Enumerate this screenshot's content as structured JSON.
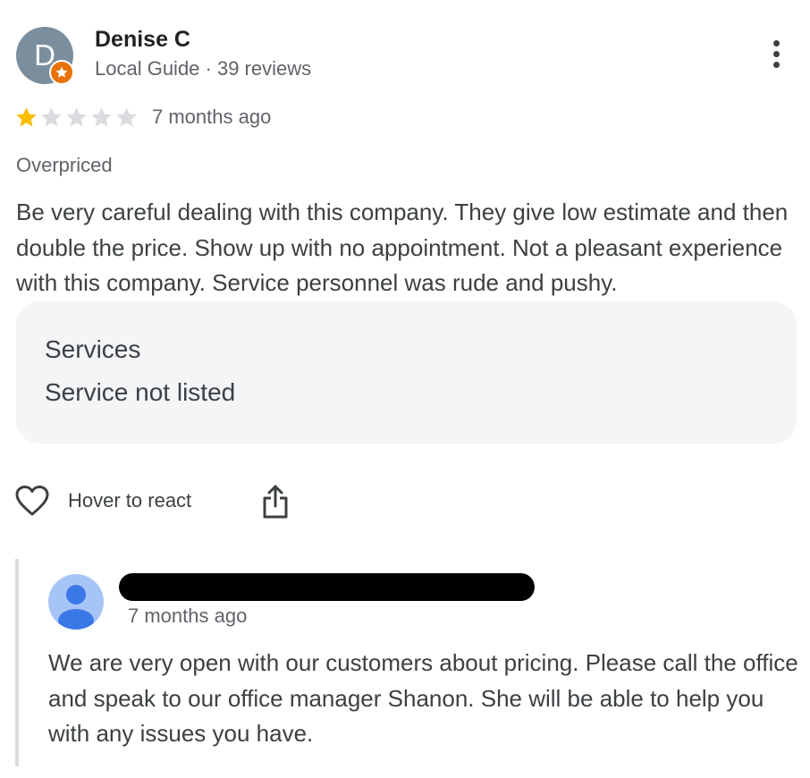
{
  "review": {
    "reviewer": {
      "initial": "D",
      "name": "Denise C",
      "meta": "Local Guide · 39 reviews",
      "avatar_color": "#7b8e9d",
      "badge_icon": "local-guide-star-icon",
      "badge_color": "#e8710a"
    },
    "more_icon": "more-vert-icon",
    "rating": {
      "value": 1,
      "max": 5,
      "filled_color": "#fbbc04",
      "empty_color": "#dadce0"
    },
    "date": "7 months ago",
    "tag": "Overpriced",
    "text": "Be very careful dealing with this company. They give low estimate and then double the price. Show up with no appointment. Not a pleasant experience with this company. Service personnel was rude and pushy.",
    "services": {
      "title": "Services",
      "value": "Service not listed"
    },
    "actions": {
      "react_label": "Hover to react",
      "react_icon": "heart-outline-icon",
      "share_icon": "share-icon"
    }
  },
  "response": {
    "owner_name_redacted": "",
    "avatar_icon": "person-icon",
    "date": "7 months ago",
    "text": "We are very open with our customers about pricing. Please call the office and speak to our office manager Shanon. She will be able to help you with any issues you have."
  }
}
